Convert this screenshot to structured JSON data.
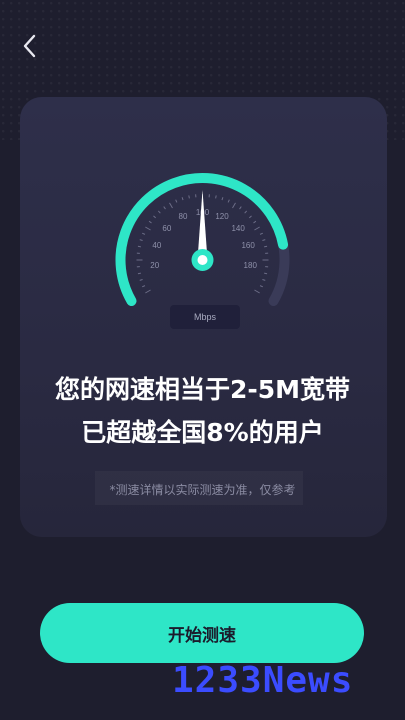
{
  "gauge": {
    "ticks": [
      "20",
      "40",
      "60",
      "80",
      "100",
      "120",
      "140",
      "160",
      "180"
    ],
    "unit": "Mbps",
    "needle_value": 100,
    "range": [
      0,
      200
    ],
    "fill_percent": 0.83,
    "accent": "#2ee6c7"
  },
  "result": {
    "line1": "您的网速相当于2-5M宽带",
    "line2": "已超越全国8%的用户"
  },
  "note": "*测速详情以实际测速为准，仅参考",
  "start_button": "开始测速",
  "watermark": "1233News",
  "icons": {
    "back": "chevron-left-icon"
  }
}
